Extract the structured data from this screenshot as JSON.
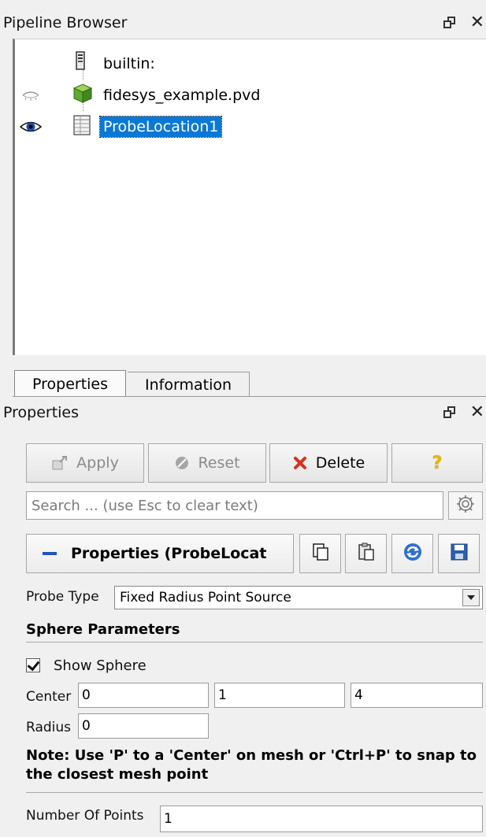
{
  "pipeline_browser": {
    "title": "Pipeline Browser",
    "items": [
      {
        "label": "builtin:",
        "visibility": "none",
        "icon": "server-icon"
      },
      {
        "label": "fidesys_example.pvd",
        "visibility": "hidden",
        "icon": "cube-icon"
      },
      {
        "label": "ProbeLocation1",
        "visibility": "visible",
        "icon": "table-icon",
        "selected": true
      }
    ]
  },
  "tabs": [
    {
      "label": "Properties",
      "active": true
    },
    {
      "label": "Information",
      "active": false
    }
  ],
  "properties_panel": {
    "title": "Properties",
    "buttons": {
      "apply": "Apply",
      "reset": "Reset",
      "delete": "Delete",
      "help": "?"
    },
    "search": {
      "placeholder": "Search ... (use Esc to clear text)",
      "value": ""
    },
    "section_label": "Properties (ProbeLocat",
    "probe_type": {
      "label": "Probe Type",
      "value": "Fixed Radius Point Source"
    },
    "sphere_parameters": {
      "header": "Sphere Parameters",
      "show_sphere_label": "Show Sphere",
      "show_sphere_checked": true,
      "center_label": "Center",
      "center": [
        "0",
        "1",
        "4"
      ],
      "radius_label": "Radius",
      "radius": "0"
    },
    "note": "Note: Use 'P' to a 'Center' on mesh or 'Ctrl+P' to snap to the closest mesh point",
    "number_of_points": {
      "label": "Number Of Points",
      "value": "1"
    }
  },
  "colors": {
    "selection": "#0a78d7",
    "delete_red": "#d6321f",
    "help_yellow": "#e8b800",
    "window_bg": "#f0f0f0"
  }
}
